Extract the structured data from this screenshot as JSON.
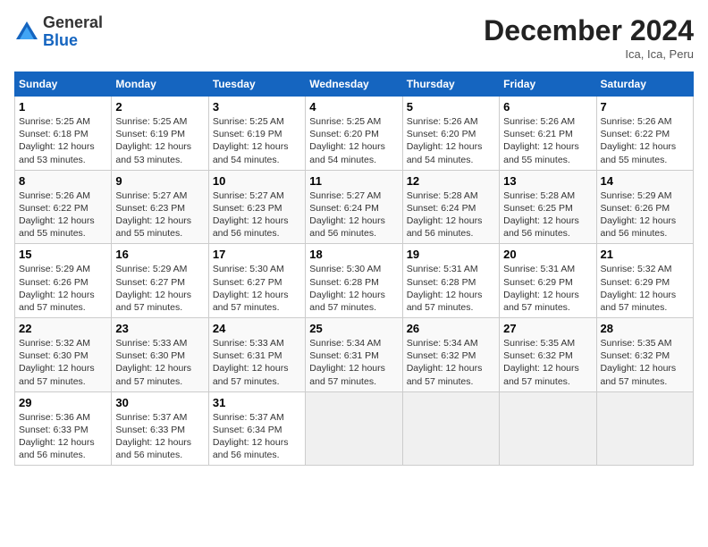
{
  "header": {
    "logo_general": "General",
    "logo_blue": "Blue",
    "month_title": "December 2024",
    "location": "Ica, Ica, Peru"
  },
  "weekdays": [
    "Sunday",
    "Monday",
    "Tuesday",
    "Wednesday",
    "Thursday",
    "Friday",
    "Saturday"
  ],
  "weeks": [
    [
      {
        "day": "1",
        "info": "Sunrise: 5:25 AM\nSunset: 6:18 PM\nDaylight: 12 hours\nand 53 minutes."
      },
      {
        "day": "2",
        "info": "Sunrise: 5:25 AM\nSunset: 6:19 PM\nDaylight: 12 hours\nand 53 minutes."
      },
      {
        "day": "3",
        "info": "Sunrise: 5:25 AM\nSunset: 6:19 PM\nDaylight: 12 hours\nand 54 minutes."
      },
      {
        "day": "4",
        "info": "Sunrise: 5:25 AM\nSunset: 6:20 PM\nDaylight: 12 hours\nand 54 minutes."
      },
      {
        "day": "5",
        "info": "Sunrise: 5:26 AM\nSunset: 6:20 PM\nDaylight: 12 hours\nand 54 minutes."
      },
      {
        "day": "6",
        "info": "Sunrise: 5:26 AM\nSunset: 6:21 PM\nDaylight: 12 hours\nand 55 minutes."
      },
      {
        "day": "7",
        "info": "Sunrise: 5:26 AM\nSunset: 6:22 PM\nDaylight: 12 hours\nand 55 minutes."
      }
    ],
    [
      {
        "day": "8",
        "info": "Sunrise: 5:26 AM\nSunset: 6:22 PM\nDaylight: 12 hours\nand 55 minutes."
      },
      {
        "day": "9",
        "info": "Sunrise: 5:27 AM\nSunset: 6:23 PM\nDaylight: 12 hours\nand 55 minutes."
      },
      {
        "day": "10",
        "info": "Sunrise: 5:27 AM\nSunset: 6:23 PM\nDaylight: 12 hours\nand 56 minutes."
      },
      {
        "day": "11",
        "info": "Sunrise: 5:27 AM\nSunset: 6:24 PM\nDaylight: 12 hours\nand 56 minutes."
      },
      {
        "day": "12",
        "info": "Sunrise: 5:28 AM\nSunset: 6:24 PM\nDaylight: 12 hours\nand 56 minutes."
      },
      {
        "day": "13",
        "info": "Sunrise: 5:28 AM\nSunset: 6:25 PM\nDaylight: 12 hours\nand 56 minutes."
      },
      {
        "day": "14",
        "info": "Sunrise: 5:29 AM\nSunset: 6:26 PM\nDaylight: 12 hours\nand 56 minutes."
      }
    ],
    [
      {
        "day": "15",
        "info": "Sunrise: 5:29 AM\nSunset: 6:26 PM\nDaylight: 12 hours\nand 57 minutes."
      },
      {
        "day": "16",
        "info": "Sunrise: 5:29 AM\nSunset: 6:27 PM\nDaylight: 12 hours\nand 57 minutes."
      },
      {
        "day": "17",
        "info": "Sunrise: 5:30 AM\nSunset: 6:27 PM\nDaylight: 12 hours\nand 57 minutes."
      },
      {
        "day": "18",
        "info": "Sunrise: 5:30 AM\nSunset: 6:28 PM\nDaylight: 12 hours\nand 57 minutes."
      },
      {
        "day": "19",
        "info": "Sunrise: 5:31 AM\nSunset: 6:28 PM\nDaylight: 12 hours\nand 57 minutes."
      },
      {
        "day": "20",
        "info": "Sunrise: 5:31 AM\nSunset: 6:29 PM\nDaylight: 12 hours\nand 57 minutes."
      },
      {
        "day": "21",
        "info": "Sunrise: 5:32 AM\nSunset: 6:29 PM\nDaylight: 12 hours\nand 57 minutes."
      }
    ],
    [
      {
        "day": "22",
        "info": "Sunrise: 5:32 AM\nSunset: 6:30 PM\nDaylight: 12 hours\nand 57 minutes."
      },
      {
        "day": "23",
        "info": "Sunrise: 5:33 AM\nSunset: 6:30 PM\nDaylight: 12 hours\nand 57 minutes."
      },
      {
        "day": "24",
        "info": "Sunrise: 5:33 AM\nSunset: 6:31 PM\nDaylight: 12 hours\nand 57 minutes."
      },
      {
        "day": "25",
        "info": "Sunrise: 5:34 AM\nSunset: 6:31 PM\nDaylight: 12 hours\nand 57 minutes."
      },
      {
        "day": "26",
        "info": "Sunrise: 5:34 AM\nSunset: 6:32 PM\nDaylight: 12 hours\nand 57 minutes."
      },
      {
        "day": "27",
        "info": "Sunrise: 5:35 AM\nSunset: 6:32 PM\nDaylight: 12 hours\nand 57 minutes."
      },
      {
        "day": "28",
        "info": "Sunrise: 5:35 AM\nSunset: 6:32 PM\nDaylight: 12 hours\nand 57 minutes."
      }
    ],
    [
      {
        "day": "29",
        "info": "Sunrise: 5:36 AM\nSunset: 6:33 PM\nDaylight: 12 hours\nand 56 minutes."
      },
      {
        "day": "30",
        "info": "Sunrise: 5:37 AM\nSunset: 6:33 PM\nDaylight: 12 hours\nand 56 minutes."
      },
      {
        "day": "31",
        "info": "Sunrise: 5:37 AM\nSunset: 6:34 PM\nDaylight: 12 hours\nand 56 minutes."
      },
      null,
      null,
      null,
      null
    ]
  ]
}
